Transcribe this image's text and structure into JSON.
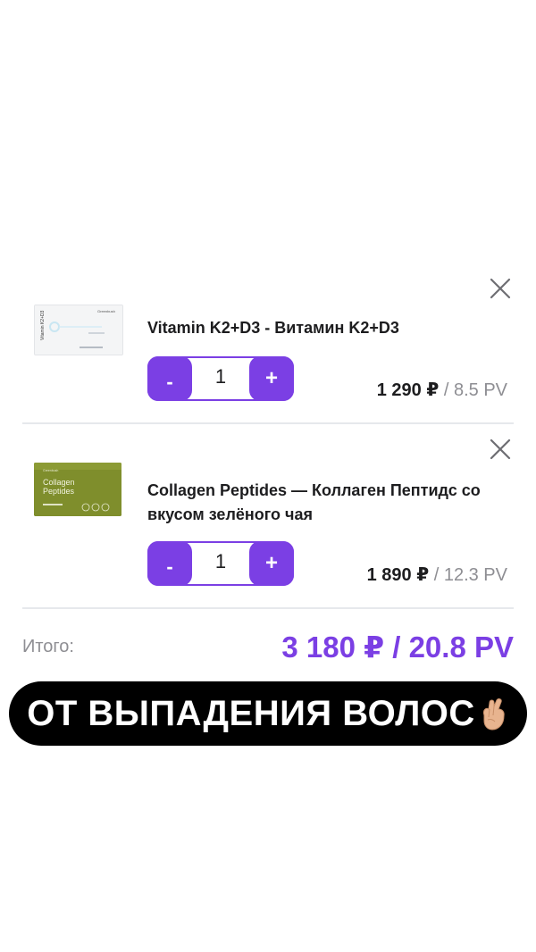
{
  "cart": {
    "items": [
      {
        "name": "Vitamin K2+D3 - Витамин K2+D3",
        "quantity": "1",
        "minus_label": "-",
        "plus_label": "+",
        "price": "1 290 ₽",
        "separator": " / ",
        "pv": "8.5 PV",
        "thumbnail": {
          "brand": "Greenbush",
          "product": "Vitamin K2+D3"
        }
      },
      {
        "name": "Collagen Peptides — Коллаген Пептидс со вкусом зелёного чая",
        "quantity": "1",
        "minus_label": "-",
        "plus_label": "+",
        "price": "1 890 ₽",
        "separator": " / ",
        "pv": "12.3 PV",
        "thumbnail": {
          "brand": "Greenbush",
          "product_line1": "Collagen",
          "product_line2": "Peptides"
        }
      }
    ],
    "total_label": "Итого:",
    "total_value": "3 180 ₽ / 20.8 PV"
  },
  "caption": {
    "text": "ОТ ВЫПАДЕНИЯ ВОЛОС",
    "emoji": "crossed-fingers-icon"
  },
  "colors": {
    "accent": "#7b3fe4",
    "text": "#1d1d1f",
    "muted": "#8e8e93",
    "divider": "#e6e8ec",
    "banner": "#000000"
  }
}
